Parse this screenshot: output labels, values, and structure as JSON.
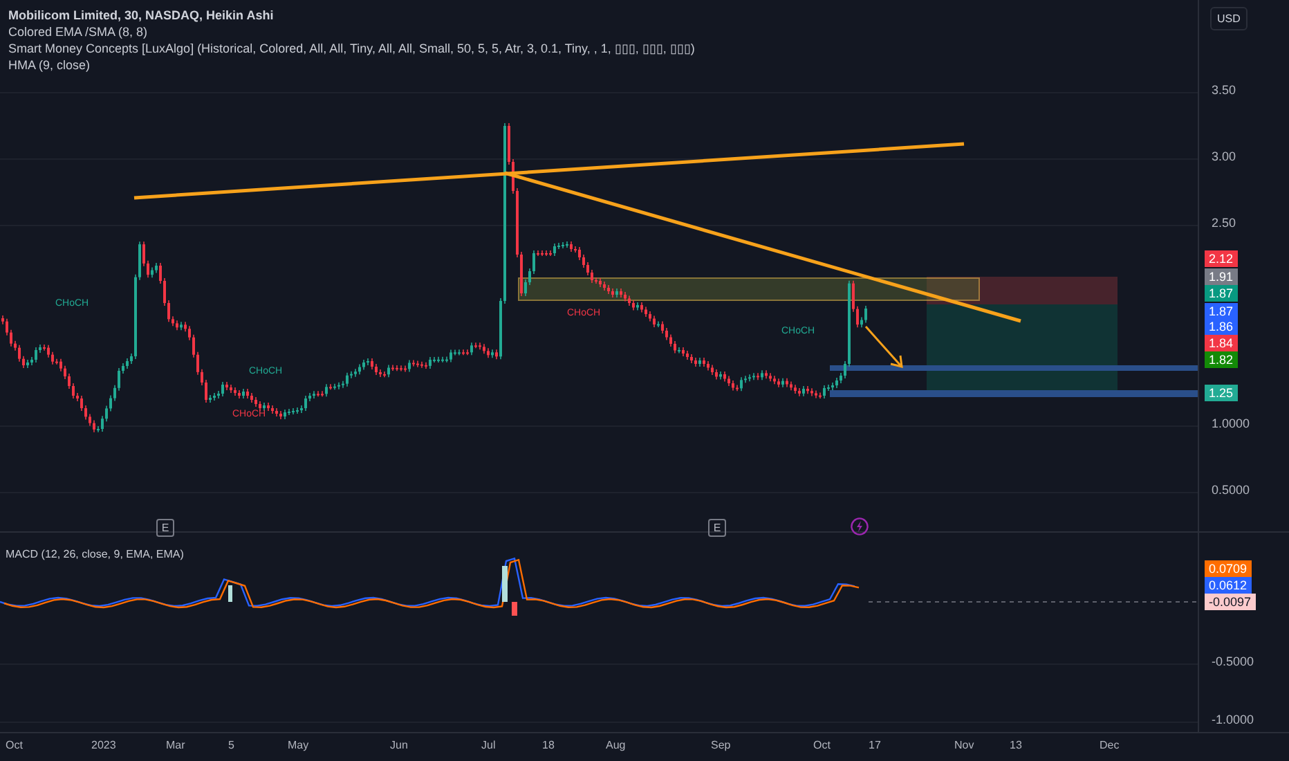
{
  "legend": {
    "symbol": "Mobilicom Limited, 30, NASDAQ, Heikin Ashi",
    "indicators": [
      "Colored EMA /SMA (8, 8)",
      "Smart Money Concepts [LuxAlgo] (Historical, Colored, All, All, Tiny, All, All, Small, 50, 5, 5, Atr, 3, 0.1, Tiny, , 1, ▯▯▯, ▯▯▯, ▯▯▯)",
      "HMA (9, close)"
    ]
  },
  "currency_button": "USD",
  "price_axis": [
    "3.50",
    "3.00",
    "2.50",
    "1.0000",
    "0.5000"
  ],
  "price_badges": [
    {
      "label": "2.12",
      "color": "#f23645"
    },
    {
      "label": "1.91",
      "color": "#787b86"
    },
    {
      "label": "1.87",
      "color": "#089981"
    },
    {
      "label": "1.87",
      "color": "#2962ff"
    },
    {
      "label": "1.86",
      "color": "#2962ff"
    },
    {
      "label": "1.84",
      "color": "#f23645"
    },
    {
      "label": "1.82",
      "color": "#138a07"
    },
    {
      "label": "1.25",
      "color": "#22ab94"
    }
  ],
  "chart_labels": [
    {
      "text": "CHoCH",
      "color": "#22ab94"
    },
    {
      "text": "CHoCH",
      "color": "#22ab94"
    },
    {
      "text": "CHoCH",
      "color": "#f23645"
    },
    {
      "text": "CHoCH",
      "color": "#f23645"
    },
    {
      "text": "CHoCH",
      "color": "#22ab94"
    }
  ],
  "event_markers": [
    "E",
    "E"
  ],
  "macd": {
    "legend": "MACD (12, 26, close, 9, EMA, EMA)",
    "axis": [
      "-0.5000",
      "-1.0000"
    ],
    "badges": [
      {
        "label": "0.0709",
        "color": "#ff6d00"
      },
      {
        "label": "0.0612",
        "color": "#2962ff"
      },
      {
        "label": "-0.0097",
        "color": "#fccbcd"
      }
    ]
  },
  "time_axis": [
    "Oct",
    "2023",
    "Mar",
    "5",
    "May",
    "Jun",
    "Jul",
    "18",
    "Aug",
    "Sep",
    "Oct",
    "17",
    "Nov",
    "13",
    "Dec"
  ]
}
